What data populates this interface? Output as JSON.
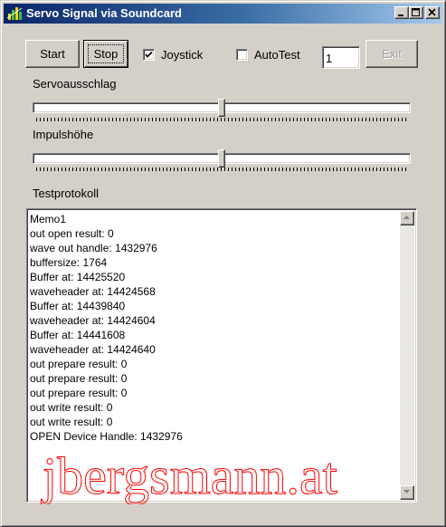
{
  "window": {
    "title": "Servo Signal via Soundcard",
    "minimize": "_",
    "maximize": "□",
    "close": "×"
  },
  "toolbar": {
    "start_label": "Start",
    "stop_label": "Stop",
    "joystick_label": "Joystick",
    "joystick_checked": true,
    "autotest_label": "AutoTest",
    "autotest_checked": false,
    "count_value": "1",
    "exit_label": "Exit"
  },
  "sliders": {
    "servo_label": "Servoausschlag",
    "servo_value": 0.5,
    "impulse_label": "Impulshöhe",
    "impulse_value": 0.5
  },
  "log": {
    "label": "Testprotokoll",
    "lines": [
      "Memo1",
      "out open result: 0",
      "wave out handle: 1432976",
      "buffersize: 1764",
      "Buffer at: 14425520",
      "waveheader at: 14424568",
      "Buffer at: 14439840",
      "waveheader at: 14424604",
      "Buffer at: 14441608",
      "waveheader at: 14424640",
      "out prepare result: 0",
      "out prepare result: 0",
      "out prepare result: 0",
      "out write result: 0",
      "out write result: 0",
      "OPEN Device Handle: 1432976"
    ]
  },
  "watermark": {
    "text": "jbergsmann.at",
    "color": "#ff0000"
  }
}
